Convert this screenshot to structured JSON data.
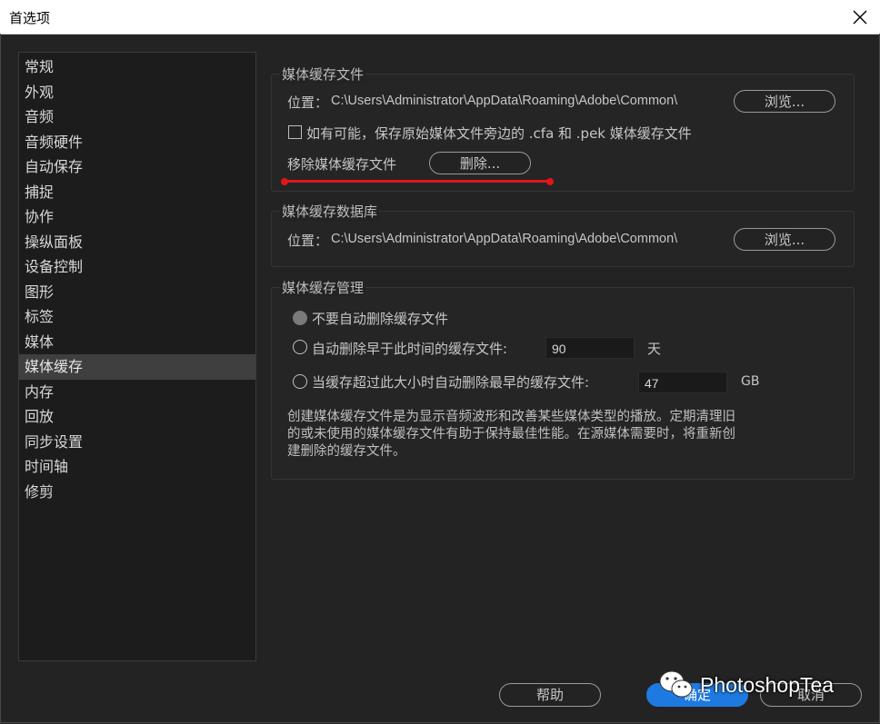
{
  "window": {
    "title": "首选项"
  },
  "sidebar": {
    "items": [
      {
        "label": "常规"
      },
      {
        "label": "外观"
      },
      {
        "label": "音频"
      },
      {
        "label": "音频硬件"
      },
      {
        "label": "自动保存"
      },
      {
        "label": "捕捉"
      },
      {
        "label": "协作"
      },
      {
        "label": "操纵面板"
      },
      {
        "label": "设备控制"
      },
      {
        "label": "图形"
      },
      {
        "label": "标签"
      },
      {
        "label": "媒体"
      },
      {
        "label": "媒体缓存",
        "active": true
      },
      {
        "label": "内存"
      },
      {
        "label": "回放"
      },
      {
        "label": "同步设置"
      },
      {
        "label": "时间轴"
      },
      {
        "label": "修剪"
      }
    ]
  },
  "media_cache_files": {
    "title": "媒体缓存文件",
    "location_label": "位置：",
    "location_path": "C:\\Users\\Administrator\\AppData\\Roaming\\Adobe\\Common\\",
    "browse_label": "浏览...",
    "save_next_label": "如有可能，保存原始媒体文件旁边的 .cfa 和 .pek 媒体缓存文件",
    "save_next_checked": false,
    "remove_label": "移除媒体缓存文件",
    "delete_label": "删除..."
  },
  "media_cache_db": {
    "title": "媒体缓存数据库",
    "location_label": "位置：",
    "location_path": "C:\\Users\\Administrator\\AppData\\Roaming\\Adobe\\Common\\",
    "browse_label": "浏览..."
  },
  "media_cache_management": {
    "title": "媒体缓存管理",
    "option_never": "不要自动删除缓存文件",
    "option_older": "自动删除早于此时间的缓存文件:",
    "older_value": "90",
    "older_unit": "天",
    "option_size": "当缓存超过此大小时自动删除最早的缓存文件:",
    "size_value": "47",
    "size_unit": "GB",
    "selected": "never",
    "description": "创建媒体缓存文件是为显示音频波形和改善某些媒体类型的播放。定期清理旧的或未使用的媒体缓存文件有助于保持最佳性能。在源媒体需要时，将重新创建删除的缓存文件。"
  },
  "footer": {
    "help_label": "帮助",
    "ok_label": "确定",
    "cancel_label": "取消"
  },
  "watermark": {
    "text": "PhotoshopTea"
  },
  "colors": {
    "accent": "#1d7ae0",
    "annotation": "#e0161b",
    "background": "#232323"
  }
}
